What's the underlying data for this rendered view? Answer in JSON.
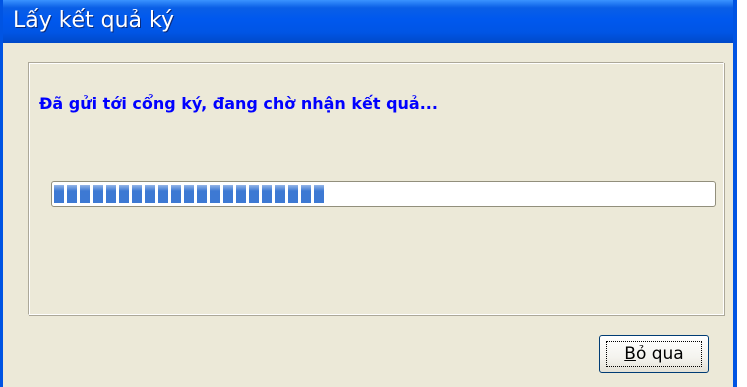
{
  "window": {
    "title": "Lấy kết quả ký"
  },
  "status": {
    "message": "Đã gửi tới cổng ký, đang chờ nhận kết quả..."
  },
  "progress": {
    "percent": 41
  },
  "buttons": {
    "cancel": {
      "mnemonic": "B",
      "rest": "ỏ qua"
    }
  },
  "colors": {
    "title_bar": "#0058ee",
    "status_text": "#0000ff",
    "progress_block": "#3d79d3",
    "dialog_bg": "#ece9d8"
  }
}
